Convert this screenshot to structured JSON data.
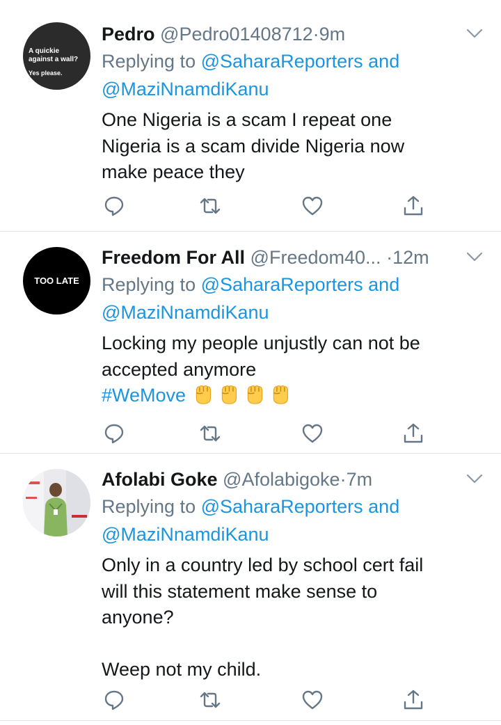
{
  "tweets": [
    {
      "name": "Pedro",
      "handle": "@Pedro01408712",
      "time": "9m",
      "avatar_text": [
        "A quickie",
        "against a wall?",
        "Yes please."
      ],
      "replying_prefix": "Replying to",
      "reply_to_1": "@SaharaReporters",
      "reply_and": "and",
      "reply_to_2": "@MaziNnamdiKanu",
      "text_lines": [
        "One Nigeria is a scam I repeat one",
        "Nigeria is a scam divide Nigeria now",
        "make peace they"
      ]
    },
    {
      "name": "Freedom For All",
      "handle": "@Freedom40...",
      "time": "12m",
      "avatar_text": "TOO LATE",
      "replying_prefix": "Replying to",
      "reply_to_1": "@SaharaReporters",
      "reply_and": "and",
      "reply_to_2": "@MaziNnamdiKanu",
      "text_lines": [
        "Locking my people unjustly can not be",
        "accepted anymore"
      ],
      "hashtag": "#WeMove",
      "emoji_count": 4
    },
    {
      "name": "Afolabi Goke",
      "handle": "@Afolabigoke",
      "time": "7m",
      "replying_prefix": "Replying to",
      "reply_to_1": "@SaharaReporters",
      "reply_and": "and",
      "reply_to_2": "@MaziNnamdiKanu",
      "text_lines": [
        "Only in a country led by school cert fail",
        "will this statement make sense to",
        "anyone?"
      ],
      "text_lines_2": [
        "Weep not my child."
      ]
    }
  ],
  "separator": "·",
  "icons": {
    "reply": "reply-icon",
    "retweet": "retweet-icon",
    "like": "heart-icon",
    "share": "share-icon",
    "caret": "chevron-down-icon"
  },
  "colors": {
    "link": "#1b95e0",
    "secondary": "#657786",
    "primary_text": "#14171a",
    "divider": "#dfe3e6"
  }
}
